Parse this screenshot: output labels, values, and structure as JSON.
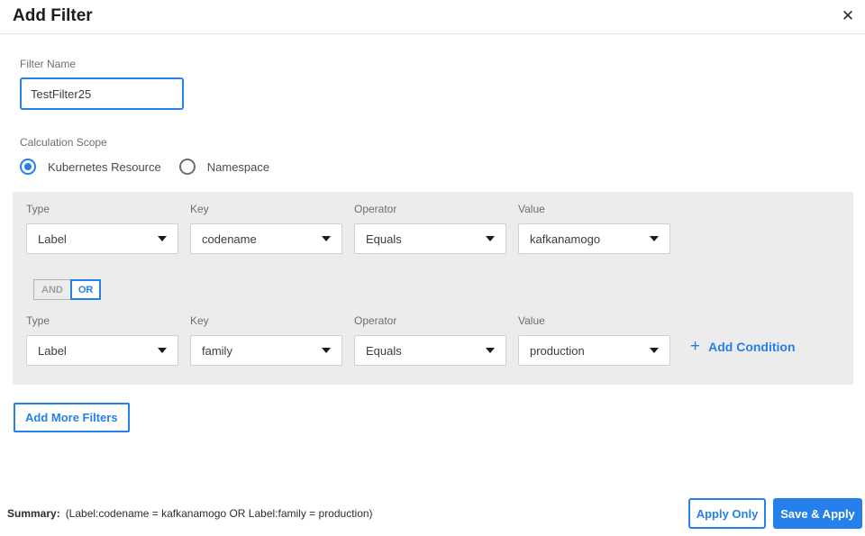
{
  "header": {
    "title": "Add Filter",
    "close_icon_glyph": "✕"
  },
  "filter_name": {
    "label": "Filter Name",
    "value": "TestFilter25"
  },
  "calculation_scope": {
    "label": "Calculation Scope",
    "options": [
      {
        "label": "Kubernetes Resource",
        "selected": true
      },
      {
        "label": "Namespace",
        "selected": false
      }
    ]
  },
  "conditions": {
    "field_labels": {
      "type": "Type",
      "key": "Key",
      "operator": "Operator",
      "value": "Value"
    },
    "rows": [
      {
        "type": "Label",
        "key": "codename",
        "operator": "Equals",
        "value": "kafkanamogo"
      },
      {
        "type": "Label",
        "key": "family",
        "operator": "Equals",
        "value": "production"
      }
    ],
    "logic_toggle": {
      "and_label": "AND",
      "or_label": "OR",
      "selected": "OR"
    },
    "add_condition": {
      "plus_glyph": "+",
      "label": "Add Condition"
    }
  },
  "add_more_filters_label": "Add More Filters",
  "footer": {
    "summary_label": "Summary:",
    "summary_text": "(Label:codename = kafkanamogo OR Label:family = production)",
    "apply_only_label": "Apply Only",
    "save_apply_label": "Save & Apply"
  },
  "colors": {
    "accent_blue": "#2680eb",
    "panel_background": "#ececec",
    "label_gray": "#6e6e6e"
  }
}
